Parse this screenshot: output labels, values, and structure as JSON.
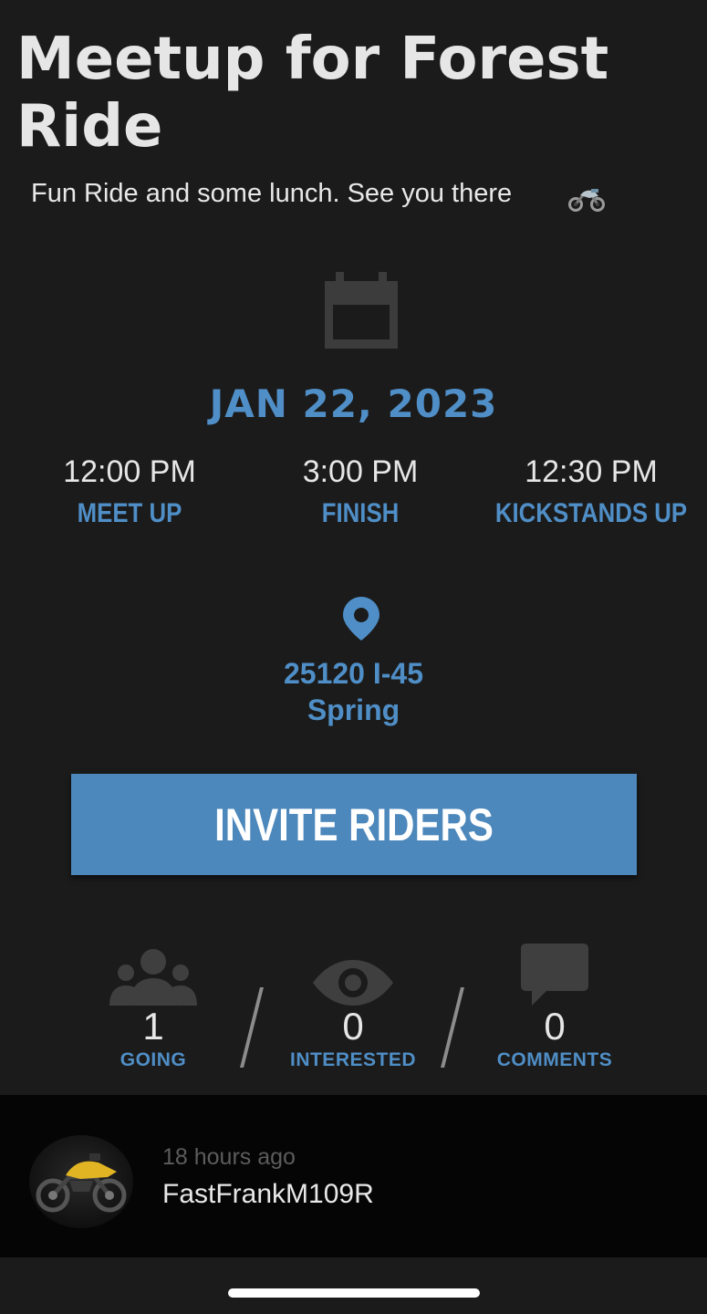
{
  "event": {
    "title": "Meetup for Forest Ride",
    "description": "Fun Ride and some lunch. See you there",
    "date": "JAN 22, 2023"
  },
  "times": [
    {
      "time": "12:00 PM",
      "label": "MEET UP"
    },
    {
      "time": "3:00 PM",
      "label": "FINISH"
    },
    {
      "time": "12:30 PM",
      "label": "KICKSTANDS UP"
    }
  ],
  "location": {
    "line1": "25120 I-45",
    "line2": "Spring"
  },
  "invite_button": {
    "label": "INVITE RIDERS"
  },
  "stats": [
    {
      "count": "1",
      "label": "GOING",
      "icon": "group-icon"
    },
    {
      "count": "0",
      "label": "INTERESTED",
      "icon": "eye-icon"
    },
    {
      "count": "0",
      "label": "COMMENTS",
      "icon": "speech-bubble-icon"
    }
  ],
  "comment": {
    "time": "18 hours ago",
    "author": "FastFrankM109R",
    "avatar_icon": "motorcycle-avatar"
  },
  "colors": {
    "accent": "#4f8ec6",
    "button": "#4d88bc",
    "background": "#1b1b1b",
    "comment_bg": "#050505"
  }
}
